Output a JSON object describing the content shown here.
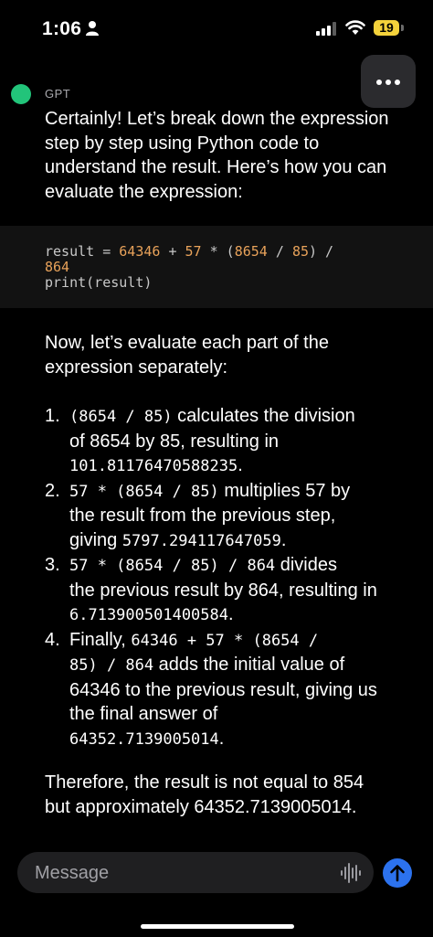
{
  "status": {
    "time": "1:06",
    "battery": "19"
  },
  "chat": {
    "sender": "GPT",
    "intro": [
      "Certainly! Let’s break down the expression",
      "step by step using Python code to",
      "understand the result. Here’s how you can",
      "evaluate the expression:"
    ],
    "code": {
      "line1_var": "result = ",
      "line1_n1": "64346",
      "line1_op1": " + ",
      "line1_n2": "57",
      "line1_op2": " * (",
      "line1_n3": "8654",
      "line1_op3": " / ",
      "line1_n4": "85",
      "line1_op4": ") /",
      "line2": "864",
      "line3": "print(result)"
    },
    "para2": [
      "Now, let’s evaluate each part of the",
      "expression separately:"
    ],
    "steps": [
      {
        "num": "1.",
        "code1": "(8654 / 85)",
        "text1": " calculates the division",
        "text2": "of 8654 by 85, resulting in",
        "code2": "101.81176470588235",
        "text3": "."
      },
      {
        "num": "2.",
        "code1": "57 * (8654 / 85)",
        "text1": " multiplies 57 by",
        "text2": "the result from the previous step,",
        "text3": "giving ",
        "code2": "5797.294117647059",
        "text4": "."
      },
      {
        "num": "3.",
        "code1": "57 * (8654 / 85) / 864",
        "text1": " divides",
        "text2": "the previous result by 864, resulting in",
        "code2": "6.713900501400584",
        "text3": "."
      },
      {
        "num": "4.",
        "text0": "Finally, ",
        "code1": "64346 + 57 * (8654 /",
        "code1b": "85) / 864",
        "text1": " adds the initial value of",
        "text2": "64346 to the previous result, giving us",
        "text3": "the final answer of",
        "code2": "64352.7139005014",
        "text4": "."
      }
    ],
    "conclusion": [
      "Therefore, the result is not equal to 854",
      "but approximately 64352.7139005014."
    ]
  },
  "composer": {
    "placeholder": "Message"
  },
  "icons": {
    "more": "more-icon",
    "voice": "voice-waveform-icon",
    "send": "arrow-up-icon",
    "person": "person-icon",
    "signal": "signal-icon",
    "wifi": "wifi-icon"
  },
  "colors": {
    "accent_send": "#2c72ee",
    "gpt_dot": "#22c47a",
    "battery": "#f4d23b",
    "code_number": "#e8a25a"
  }
}
